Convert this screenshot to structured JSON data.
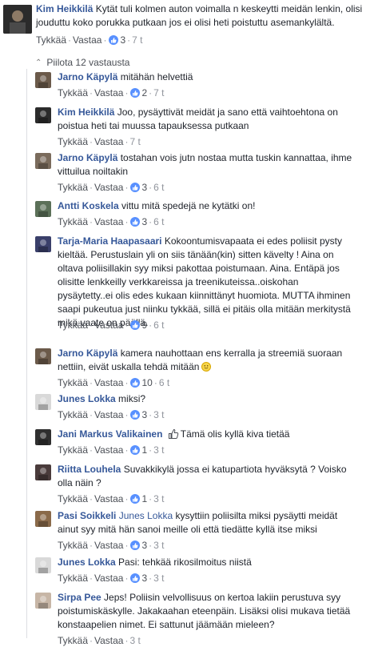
{
  "main_comment": {
    "author": "Kim Heikkilä",
    "text": "Kytät tuli kolmen auton voimalla n keskeytti meidän lenkin, olisi jouduttu koko porukka putkaan jos ei olisi heti poistuttu asemankylältä.",
    "like_label": "Tykkää",
    "reply_label": "Vastaa",
    "reactions": "3",
    "time": "7 t"
  },
  "replies_toggle": {
    "label": "Piilota 12 vastausta"
  },
  "replies": [
    {
      "author": "Jarno Käpylä",
      "text": "mitähän helvettiä",
      "like_label": "Tykkää",
      "reply_label": "Vastaa",
      "reactions": "2",
      "time": "7 t"
    },
    {
      "author": "Kim Heikkilä",
      "text": "Joo, pysäyttivät meidät ja sano että vaihtoehtona on poistua heti tai muussa tapauksessa putkaan",
      "like_label": "Tykkää",
      "reply_label": "Vastaa",
      "reactions": "",
      "time": "7 t"
    },
    {
      "author": "Jarno Käpylä",
      "text": "tostahan vois jutn nostaa mutta tuskin kannattaa, ihme vittuilua noiltakin",
      "like_label": "Tykkää",
      "reply_label": "Vastaa",
      "reactions": "3",
      "time": "6 t"
    },
    {
      "author": "Antti Koskela",
      "text": "vittu mitä spedejä ne kytätki on!",
      "like_label": "Tykkää",
      "reply_label": "Vastaa",
      "reactions": "3",
      "time": "6 t"
    },
    {
      "author": "Tarja-Maria Haapasaari",
      "text": "Kokoontumisvapaata ei edes poliisit pysty kieltää. Perustuslain yli on siis tänään(kin) sitten kävelty ! Aina on oltava poliisillakin syy miksi pakottaa poistumaan. Aina. Entäpä jos olisitte lenkkeilly verkkareissa ja treenikuteissa..oiskohan pysäytetty..ei olis edes kukaan kiinnittänyt huomiota. MUTTA ihminen saapi pukeutua just niinku tykkää, sillä ei pitäis olla mitään merkitystä mikä vaate on päällä.",
      "like_label": "Tykkää",
      "reply_label": "Vastaa",
      "reactions": "9",
      "time": "6 t"
    },
    {
      "author": "Jarno Käpylä",
      "text": "kamera nauhottaan ens kerralla ja streemiä suoraan nettiin, eivät uskalla tehdä mitään",
      "like_label": "Tykkää",
      "reply_label": "Vastaa",
      "reactions": "10",
      "time": "6 t"
    },
    {
      "author": "Junes Lokka",
      "text": "miksi?",
      "like_label": "Tykkää",
      "reply_label": "Vastaa",
      "reactions": "3",
      "time": "3 t"
    },
    {
      "author": "Jani Markus Valikainen",
      "text": "Tämä olis kyllä kiva tietää",
      "like_label": "Tykkää",
      "reply_label": "Vastaa",
      "reactions": "1",
      "time": "3 t"
    },
    {
      "author": "Riitta Louhela",
      "text": "Suvakkikylä jossa ei katupartiota hyväksytä ? Voisko olla näin ?",
      "like_label": "Tykkää",
      "reply_label": "Vastaa",
      "reactions": "1",
      "time": "3 t"
    },
    {
      "author": "Pasi Soikkeli",
      "mention": "Junes Lokka",
      "text": "kysyttiin poliisilta miksi pysäytti meidät ainut syy mitä hän sanoi meille oli että tiedätte kyllä itse miksi",
      "like_label": "Tykkää",
      "reply_label": "Vastaa",
      "reactions": "3",
      "time": "3 t"
    },
    {
      "author": "Junes Lokka",
      "text": "Pasi: tehkää rikosilmoitus niistä",
      "like_label": "Tykkää",
      "reply_label": "Vastaa",
      "reactions": "3",
      "time": "3 t"
    },
    {
      "author": "Sirpa Pee",
      "text": "Jeps! Poliisin velvollisuus on kertoa lakiin perustuva syy poistumiskäskylle. Jakakaahan eteenpäin. Lisäksi olisi mukava tietää konstaapelien nimet. Ei sattunut jäämään mieleen?",
      "like_label": "Tykkää",
      "reply_label": "Vastaa",
      "reactions": "",
      "time": "3 t"
    }
  ],
  "colors": {
    "link": "#365899",
    "meta": "#90949c",
    "like_blue": "#5890ff",
    "divider": "#dddfe2"
  }
}
